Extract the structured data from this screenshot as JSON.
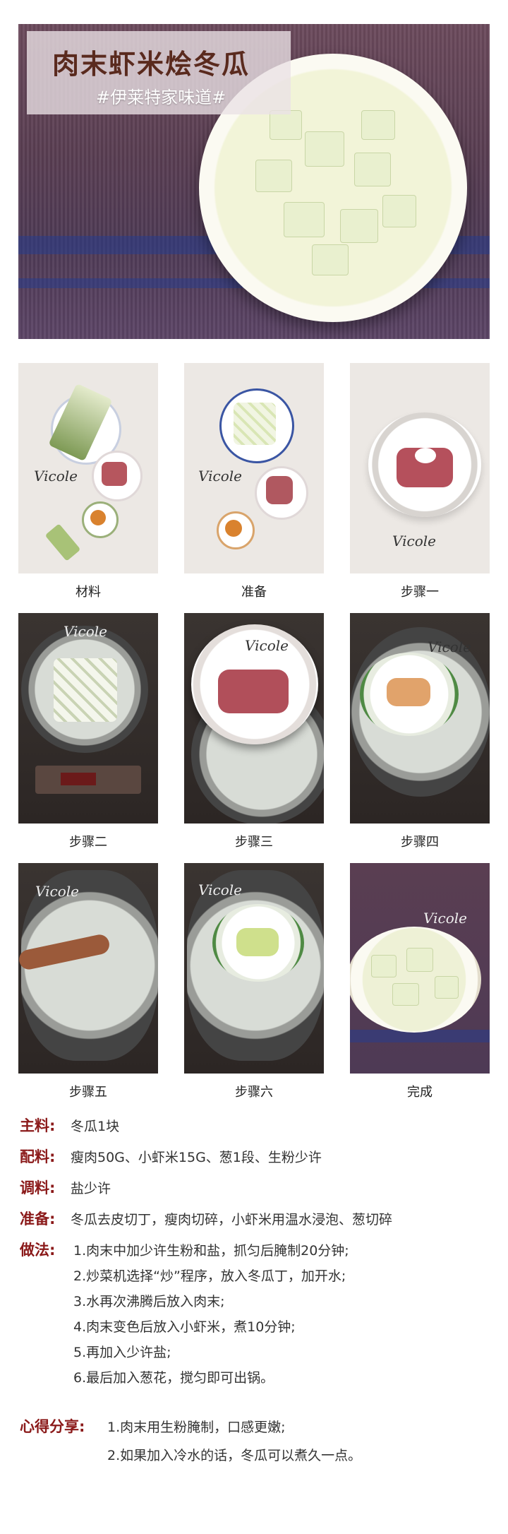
{
  "hero": {
    "title": "肉末虾米烩冬瓜",
    "subtitle": "#伊莱特家味道#"
  },
  "steps": [
    {
      "caption": "材料",
      "signature": "Vicole"
    },
    {
      "caption": "准备",
      "signature": "Vicole"
    },
    {
      "caption": "步骤一",
      "signature": "Vicole"
    },
    {
      "caption": "步骤二",
      "signature": "Vicole"
    },
    {
      "caption": "步骤三",
      "signature": "Vicole"
    },
    {
      "caption": "步骤四",
      "signature": "Vicole"
    },
    {
      "caption": "步骤五",
      "signature": "Vicole"
    },
    {
      "caption": "步骤六",
      "signature": "Vicole"
    },
    {
      "caption": "完成",
      "signature": "Vicole"
    }
  ],
  "recipe": {
    "main_label": "主料:",
    "main_value": "冬瓜1块",
    "aux_label": "配料:",
    "aux_value": "瘦肉50G、小虾米15G、葱1段、生粉少许",
    "season_label": "调料:",
    "season_value": "盐少许",
    "prep_label": "准备:",
    "prep_value": "冬瓜去皮切丁，瘦肉切碎，小虾米用温水浸泡、葱切碎",
    "method_label": "做法:",
    "method_steps": [
      "1.肉末中加少许生粉和盐，抓匀后腌制20分钟;",
      "2.炒菜机选择“炒”程序，放入冬瓜丁，加开水;",
      "3.水再次沸腾后放入肉末;",
      "4.肉末变色后放入小虾米，煮10分钟;",
      "5.再加入少许盐;",
      "6.最后加入葱花，搅匀即可出锅。"
    ],
    "tips_label": "心得分享:",
    "tips": [
      "1.肉末用生粉腌制，口感更嫩;",
      "2.如果加入冷水的话，冬瓜可以煮久一点。"
    ]
  },
  "colors": {
    "label_red": "#8b1a1a",
    "title_brown": "#5a2a1e"
  }
}
